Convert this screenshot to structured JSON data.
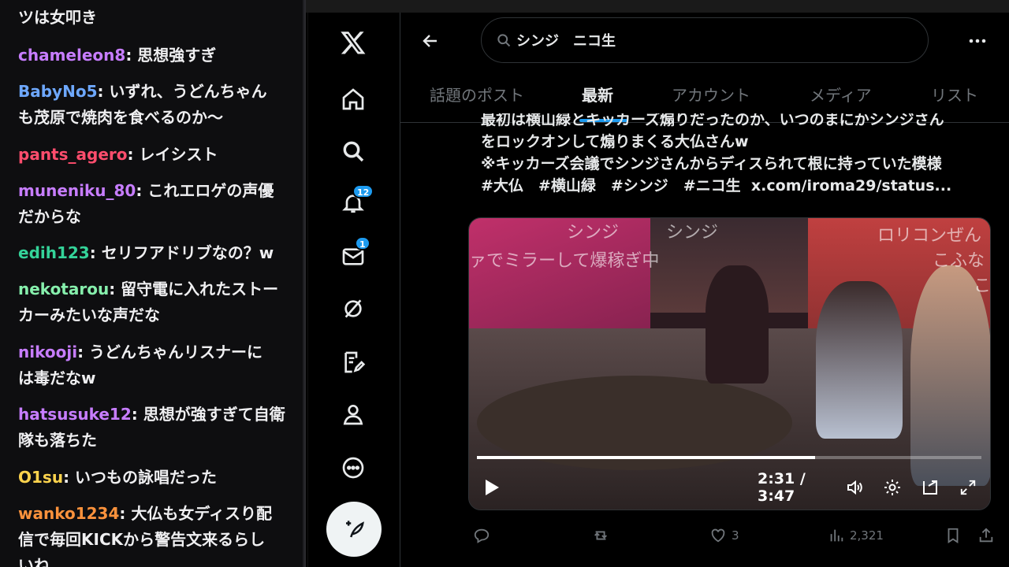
{
  "chat": {
    "messages": [
      {
        "user": "",
        "text": "ツは女叩き",
        "color": "#ff69b4"
      },
      {
        "user": "chameleon8",
        "text": ": 思想強すぎ",
        "color": "#c77dff"
      },
      {
        "user": "BabyNo5",
        "text": ": いずれ、うどんちゃん",
        "text2": "も茂原で焼肉を食べるのか〜",
        "color": "#6ea8fe"
      },
      {
        "user": "pants_agero",
        "text": ": レイシスト",
        "color": "#ff4d6d"
      },
      {
        "user": "muneniku_80",
        "text": ": これエロゲの声優",
        "text2": "だからな",
        "color": "#c77dff"
      },
      {
        "user": "edih123",
        "text": ": セリフアドリブなの？w",
        "color": "#34d399"
      },
      {
        "user": "nekotarou",
        "text": ": 留守電に入れたストー",
        "text2": "カーみたいな声だな",
        "color": "#86efac"
      },
      {
        "user": "nikooji",
        "text": ": うどんちゃんリスナーに",
        "text2": "は毒だなw",
        "color": "#c77dff"
      },
      {
        "user": "hatsusuke12",
        "text": ": 思想が強すぎて自衛",
        "text2": "隊も落ちた",
        "color": "#c77dff"
      },
      {
        "user": "O1su",
        "text": ": いつもの詠唱だった",
        "color": "#fcd34d"
      },
      {
        "user": "wanko1234",
        "text": ": 大仏も女ディスり配",
        "text2": "信で毎回KICKから警告文来るらし",
        "text3": "いね",
        "color": "#fb923c"
      }
    ]
  },
  "rail": {
    "notifications_badge": "12",
    "messages_badge": "1"
  },
  "header": {
    "search_query": "シンジ　ニコ生"
  },
  "tabs": [
    {
      "label": "話題のポスト",
      "active": false
    },
    {
      "label": "最新",
      "active": true
    },
    {
      "label": "アカウント",
      "active": false
    },
    {
      "label": "メディア",
      "active": false
    },
    {
      "label": "リスト",
      "active": false
    }
  ],
  "tweet": {
    "line_clipped": "最初は横山緑とキッカーズ煽りだったのか、いつのまにかシンジさん",
    "line1": "をロックオンして煽りまくる大仏さんw",
    "line2": "※キッカーズ会議でシンジさんからディスられて根に持っていた模様",
    "hashtags": "#大仏　#横山緑　#シンジ　#ニコ生",
    "link": "x.com/iroma29/status..."
  },
  "video": {
    "captions": [
      "シンジ",
      "シンジ",
      "ロリコンぜん",
      "ァでミラーして爆稼ぎ中",
      "こふな",
      "こ"
    ],
    "time": "2:31 / 3:47",
    "progress": 0.67
  },
  "actions": {
    "likes": "3",
    "views": "2,321"
  },
  "colors": {
    "accent": "#1d9bf0",
    "background": "#000000",
    "chat_bg": "#0e0e10"
  }
}
